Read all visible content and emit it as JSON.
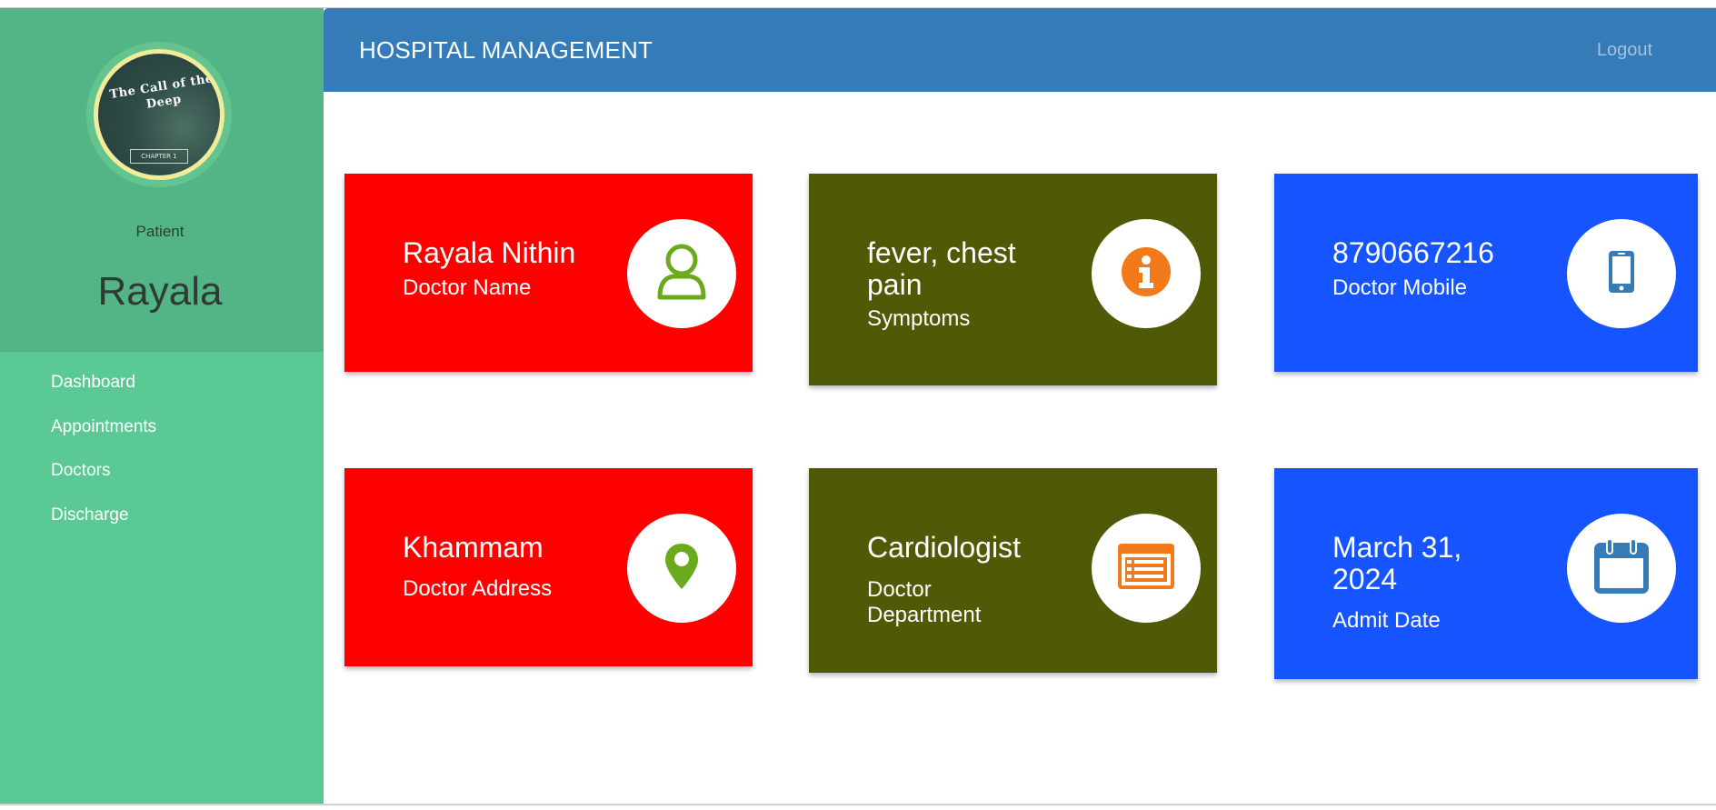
{
  "app": {
    "brand": "HOSPITAL MANAGEMENT",
    "logout_label": "Logout"
  },
  "sidebar": {
    "avatar_title": "The Call of the Deep",
    "avatar_subtitle": "CHAPTER 1",
    "role": "Patient",
    "user_name": "Rayala",
    "nav": [
      {
        "label": "Dashboard"
      },
      {
        "label": "Appointments"
      },
      {
        "label": "Doctors"
      },
      {
        "label": "Discharge"
      }
    ]
  },
  "cards": [
    {
      "value": "Rayala Nithin",
      "label": "Doctor Name",
      "icon": "user-icon",
      "color": "#ff0000",
      "icon_color": "#6aaa1c"
    },
    {
      "value": "fever, chest pain",
      "label": "Symptoms",
      "icon": "info-icon",
      "color": "#505a06",
      "icon_color": "#f27a1a"
    },
    {
      "value": "8790667216",
      "label": "Doctor Mobile",
      "icon": "mobile-phone-icon",
      "color": "#1654ff",
      "icon_color": "#347bb7"
    },
    {
      "value": "Khammam",
      "label": "Doctor Address",
      "icon": "map-pin-icon",
      "color": "#ff0000",
      "icon_color": "#6aaa1c"
    },
    {
      "value": "Cardiologist",
      "label": "Doctor Department",
      "icon": "list-card-icon",
      "color": "#505a06",
      "icon_color": "#f27a1a"
    },
    {
      "value": "March 31, 2024",
      "label": "Admit Date",
      "icon": "calendar-icon",
      "color": "#1654ff",
      "icon_color": "#347bb7"
    }
  ],
  "colors": {
    "sidebar": "#5bc994",
    "sidebar_profile": "#53b586",
    "header": "#347bb7"
  }
}
